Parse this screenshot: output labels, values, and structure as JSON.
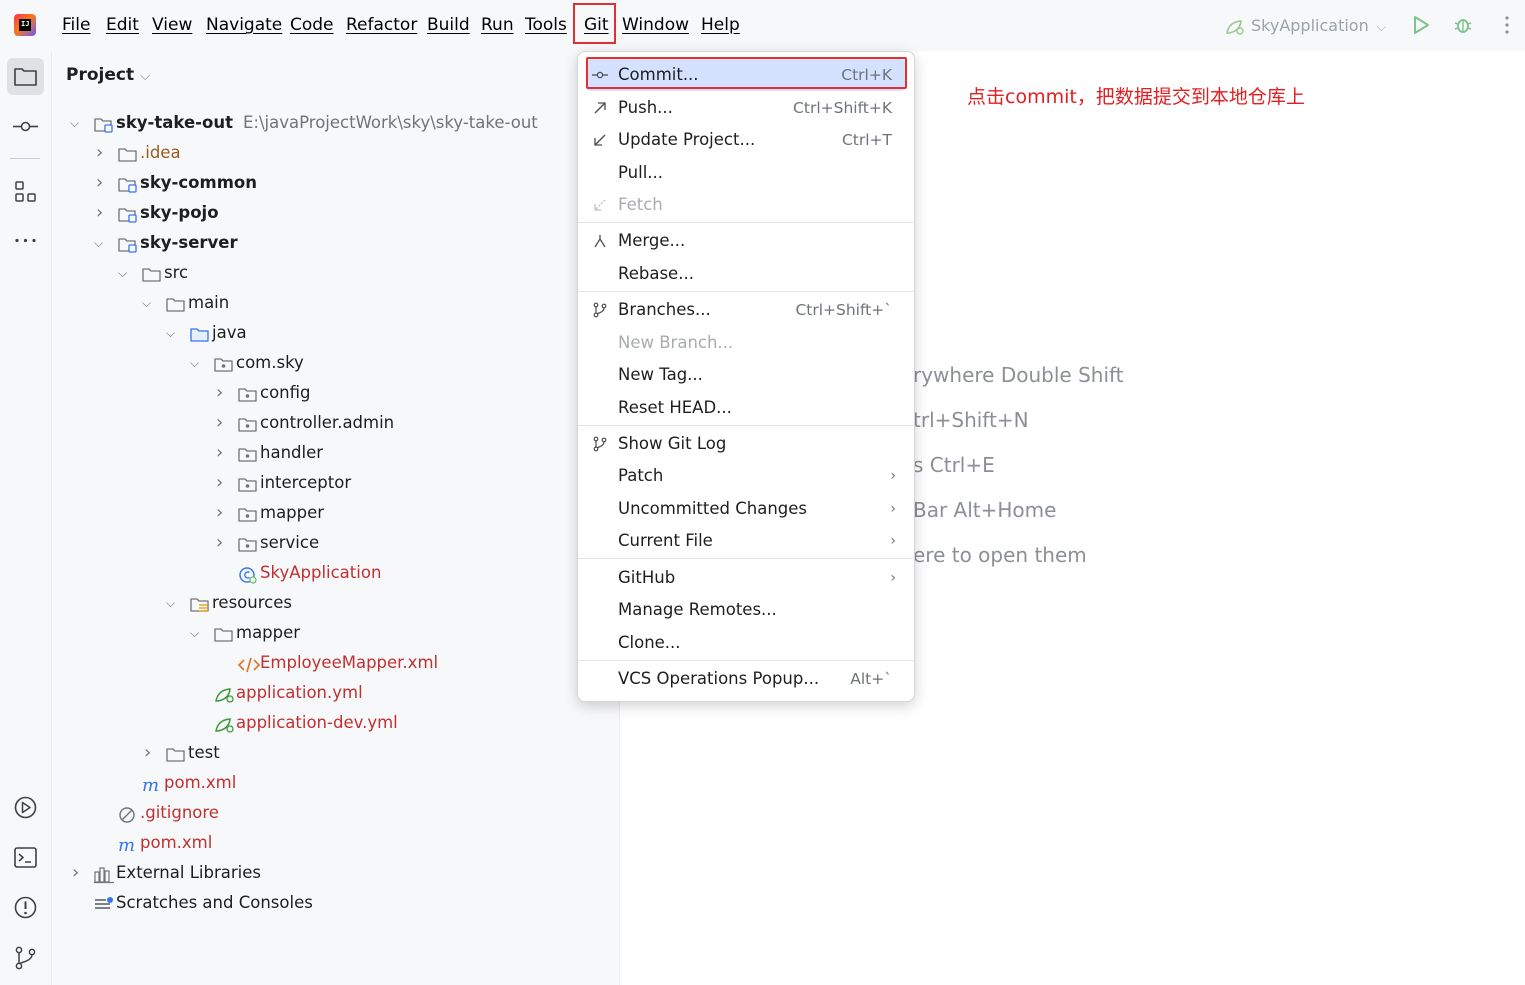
{
  "menubar": {
    "items": [
      "File",
      "Edit",
      "View",
      "Navigate",
      "Code",
      "Refactor",
      "Build",
      "Run",
      "Tools",
      "Git",
      "Window",
      "Help"
    ],
    "active": "Git"
  },
  "toolbar": {
    "run_config": "SkyApplication"
  },
  "project_panel": {
    "title": "Project",
    "tree": [
      {
        "label": "sky-take-out",
        "path": "E:\\javaProjectWork\\sky\\sky-take-out"
      },
      {
        "label": ".idea"
      },
      {
        "label": "sky-common"
      },
      {
        "label": "sky-pojo"
      },
      {
        "label": "sky-server"
      },
      {
        "label": "src"
      },
      {
        "label": "main"
      },
      {
        "label": "java"
      },
      {
        "label": "com.sky"
      },
      {
        "label": "config"
      },
      {
        "label": "controller.admin"
      },
      {
        "label": "handler"
      },
      {
        "label": "interceptor"
      },
      {
        "label": "mapper"
      },
      {
        "label": "service"
      },
      {
        "label": "SkyApplication"
      },
      {
        "label": "resources"
      },
      {
        "label": "mapper"
      },
      {
        "label": "EmployeeMapper.xml"
      },
      {
        "label": "application.yml"
      },
      {
        "label": "application-dev.yml"
      },
      {
        "label": "test"
      },
      {
        "label": "pom.xml"
      },
      {
        "label": ".gitignore"
      },
      {
        "label": "pom.xml"
      },
      {
        "label": "External Libraries"
      },
      {
        "label": "Scratches and Consoles"
      }
    ]
  },
  "git_menu": {
    "items": [
      {
        "label": "Commit...",
        "shortcut": "Ctrl+K"
      },
      {
        "label": "Push...",
        "shortcut": "Ctrl+Shift+K"
      },
      {
        "label": "Update Project...",
        "shortcut": "Ctrl+T"
      },
      {
        "label": "Pull..."
      },
      {
        "label": "Fetch"
      },
      {
        "label": "Merge..."
      },
      {
        "label": "Rebase..."
      },
      {
        "label": "Branches...",
        "shortcut": "Ctrl+Shift+`"
      },
      {
        "label": "New Branch..."
      },
      {
        "label": "New Tag..."
      },
      {
        "label": "Reset HEAD..."
      },
      {
        "label": "Show Git Log"
      },
      {
        "label": "Patch"
      },
      {
        "label": "Uncommitted Changes"
      },
      {
        "label": "Current File"
      },
      {
        "label": "GitHub"
      },
      {
        "label": "Manage Remotes..."
      },
      {
        "label": "Clone..."
      },
      {
        "label": "VCS Operations Popup...",
        "shortcut": "Alt+`"
      }
    ]
  },
  "editor_hints": [
    "rywhere Double Shift",
    "trl+Shift+N",
    "s Ctrl+E",
    "Bar Alt+Home",
    "ere to open them"
  ],
  "annotation": "点击commit，把数据提交到本地仓库上"
}
